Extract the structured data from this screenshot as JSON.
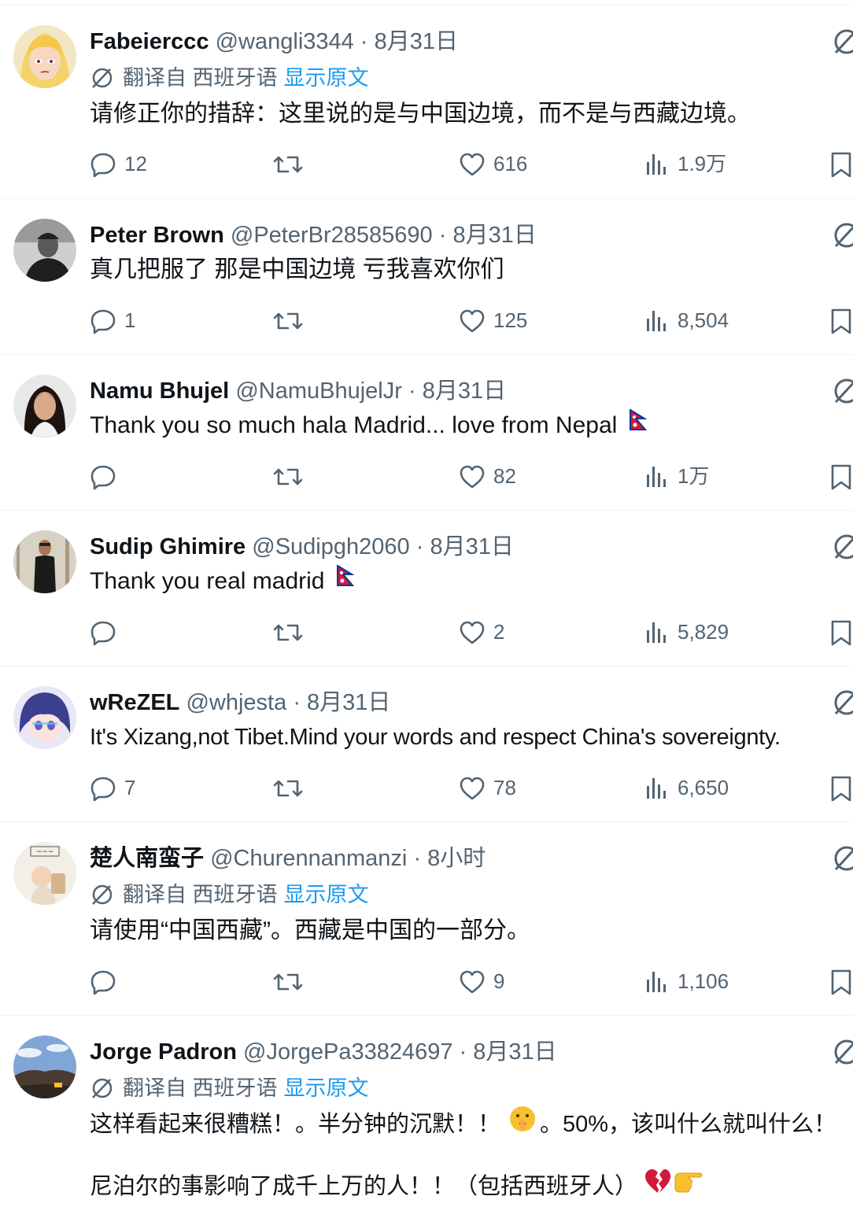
{
  "tweets": [
    {
      "name": "Fabeierccc",
      "handle": "@wangli3344",
      "sep": "·",
      "time": "8月31日",
      "translate": {
        "label": "翻译自 西班牙语",
        "show": "显示原文"
      },
      "text": "请修正你的措辞：这里说的是与中国边境，而不是与西藏边境。",
      "replies": "12",
      "likes": "616",
      "views": "1.9万"
    },
    {
      "name": "Peter Brown",
      "handle": "@PeterBr28585690",
      "sep": "·",
      "time": "8月31日",
      "text": "真几把服了 那是中国边境 亏我喜欢你们",
      "replies": "1",
      "likes": "125",
      "views": "8,504"
    },
    {
      "name": "Namu Bhujel",
      "handle": "@NamuBhujelJr",
      "sep": "·",
      "time": "8月31日",
      "text": "Thank you so much hala Madrid... love from Nepal",
      "flag": "nepal-flag",
      "replies": "",
      "likes": "82",
      "views": "1万"
    },
    {
      "name": "Sudip Ghimire",
      "handle": "@Sudipgh2060",
      "sep": "·",
      "time": "8月31日",
      "text": "Thank you real madrid",
      "flag": "nepal-flag",
      "replies": "",
      "likes": "2",
      "views": "5,829"
    },
    {
      "name": "wReZEL",
      "handle": "@whjesta",
      "sep": "·",
      "time": "8月31日",
      "text": "It's Xizang,not Tibet.Mind your words and respect China's sovereignty.",
      "replies": "7",
      "likes": "78",
      "views": "6,650"
    },
    {
      "name": "楚人南蛮子",
      "handle": "@Churennanmanzi",
      "sep": "·",
      "time": "8小时",
      "translate": {
        "label": "翻译自 西班牙语",
        "show": "显示原文"
      },
      "text": "请使用“中国西藏”。西藏是中国的一部分。",
      "replies": "",
      "likes": "9",
      "views": "1,106"
    },
    {
      "name": "Jorge Padron",
      "handle": "@JorgePa33824697",
      "sep": "·",
      "time": "8月31日",
      "translate": {
        "label": "翻译自 西班牙语",
        "show": "显示原文"
      },
      "text1a": "这样看起来很糟糕！。半分钟的沉默！！",
      "text1b": "。50%，该叫什么就叫什么！",
      "text2": "尼泊尔的事影响了成千上万的人！！（包括西班牙人）"
    }
  ],
  "colors": {
    "accent": "#1d9bf0",
    "secondary": "#536471",
    "text": "#0f1419",
    "divider": "#eff3f4"
  },
  "icons": [
    "reply-icon",
    "retweet-icon",
    "like-icon",
    "views-icon",
    "bookmark-icon",
    "grok-icon",
    "translate-icon",
    "nepal-flag",
    "shushing-face-emoji",
    "broken-heart-emoji",
    "backhand-index-pointing-right-emoji"
  ]
}
